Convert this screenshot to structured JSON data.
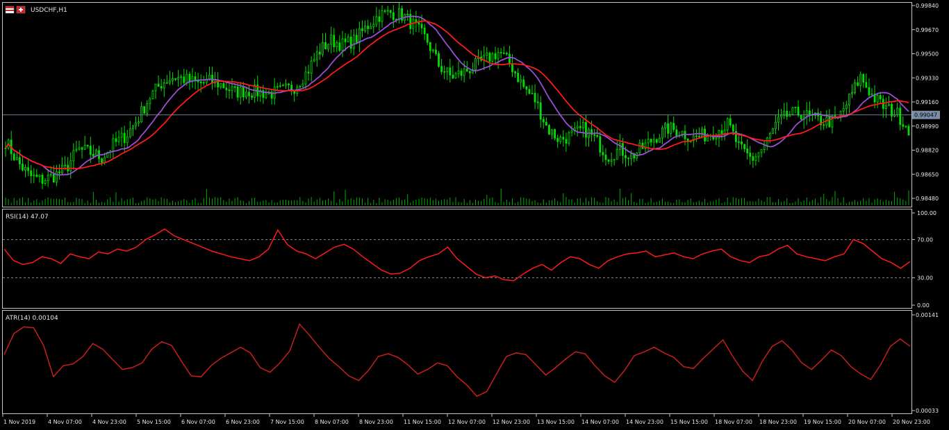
{
  "symbol_label": "USDCHF,H1",
  "colors": {
    "background": "#000000",
    "frame": "#c8c8c8",
    "candle": "#00e000",
    "volume": "#00b000",
    "ma_fast": "#9b4fd6",
    "ma_slow": "#ff1a1a",
    "rsi": "#ff1a1a",
    "atr": "#c81e1e",
    "price_line": "#7b8ca8"
  },
  "chart_data": [
    {
      "type": "candlestick",
      "title": "USDCHF,H1",
      "current_price": "0.99047",
      "current_price_value": 0.99047,
      "y_ticks": [
        "0.99840",
        "0.99670",
        "0.99500",
        "0.99330",
        "0.99160",
        "0.98990",
        "0.98820",
        "0.98650",
        "0.98480"
      ],
      "ylim": [
        0.984,
        0.9984
      ],
      "x_tick_labels": [
        "1 Nov 2019",
        "4 Nov 07:00",
        "4 Nov 23:00",
        "5 Nov 15:00",
        "6 Nov 07:00",
        "6 Nov 23:00",
        "7 Nov 15:00",
        "8 Nov 07:00",
        "8 Nov 23:00",
        "11 Nov 15:00",
        "12 Nov 07:00",
        "12 Nov 23:00",
        "13 Nov 15:00",
        "14 Nov 07:00",
        "14 Nov 23:00",
        "15 Nov 15:00",
        "18 Nov 07:00",
        "18 Nov 23:00",
        "19 Nov 15:00",
        "20 Nov 07:00",
        "20 Nov 23:00"
      ],
      "close_path": [
        0.9886,
        0.9871,
        0.9861,
        0.9858,
        0.9861,
        0.9866,
        0.988,
        0.9878,
        0.9874,
        0.9884,
        0.989,
        0.9902,
        0.9918,
        0.9928,
        0.9932,
        0.993,
        0.9927,
        0.9929,
        0.9926,
        0.9921,
        0.9922,
        0.9921,
        0.992,
        0.9922,
        0.9925,
        0.9935,
        0.995,
        0.9958,
        0.9955,
        0.9958,
        0.9968,
        0.9976,
        0.9978,
        0.9976,
        0.9968,
        0.9958,
        0.994,
        0.9932,
        0.9935,
        0.994,
        0.9945,
        0.995,
        0.994,
        0.9925,
        0.9915,
        0.9895,
        0.9887,
        0.989,
        0.9895,
        0.9887,
        0.9875,
        0.988,
        0.9875,
        0.9882,
        0.9889,
        0.9895,
        0.9893,
        0.9888,
        0.989,
        0.9893,
        0.9898,
        0.988,
        0.9873,
        0.9882,
        0.9898,
        0.9905,
        0.9906,
        0.9902,
        0.99,
        0.99,
        0.9915,
        0.9932,
        0.9918,
        0.991,
        0.9906,
        0.9895
      ],
      "series": [
        {
          "name": "",
          "type": "line",
          "role": "moving-average-fast"
        },
        {
          "name": "",
          "type": "line",
          "role": "moving-average-slow"
        }
      ]
    },
    {
      "type": "line",
      "title": "RSI(14) 47.07",
      "y_ticks": [
        "100.00",
        "70.00",
        "30.00",
        "0.00"
      ],
      "ylim": [
        0,
        100
      ],
      "levels": [
        70,
        30
      ],
      "values": [
        60,
        48,
        44,
        46,
        52,
        50,
        45,
        55,
        52,
        50,
        57,
        55,
        60,
        58,
        62,
        70,
        75,
        81,
        74,
        70,
        66,
        62,
        58,
        55,
        52,
        50,
        48,
        52,
        60,
        80,
        65,
        58,
        55,
        50,
        56,
        62,
        65,
        60,
        52,
        45,
        38,
        34,
        35,
        40,
        48,
        52,
        55,
        62,
        50,
        42,
        34,
        30,
        32,
        28,
        27,
        34,
        40,
        44,
        38,
        46,
        52,
        50,
        44,
        40,
        48,
        52,
        55,
        56,
        58,
        52,
        54,
        56,
        52,
        50,
        55,
        58,
        60,
        52,
        48,
        46,
        52,
        54,
        60,
        64,
        55,
        52,
        50,
        48,
        52,
        55,
        70,
        66,
        58,
        50,
        46,
        40,
        47
      ]
    },
    {
      "type": "line",
      "title": "ATR(14) 0.00104",
      "y_ticks": [
        "0.00141",
        "0.00033"
      ],
      "ylim": [
        0.00033,
        0.00141
      ],
      "values": [
        0.00095,
        0.00118,
        0.00125,
        0.00124,
        0.00105,
        0.00071,
        0.00083,
        0.00085,
        0.00093,
        0.00107,
        0.00101,
        0.0009,
        0.00079,
        0.00081,
        0.00086,
        0.00101,
        0.00109,
        0.00105,
        0.00088,
        0.00072,
        0.00071,
        0.00083,
        0.00091,
        0.00097,
        0.00103,
        0.00097,
        0.00081,
        0.00076,
        0.00086,
        0.00099,
        0.00128,
        0.00116,
        0.00103,
        0.00091,
        0.00082,
        0.00072,
        0.00067,
        0.00078,
        0.00093,
        0.00096,
        0.00092,
        0.00084,
        0.00074,
        0.00079,
        0.00086,
        0.00083,
        0.00071,
        0.00062,
        0.0005,
        0.00055,
        0.00074,
        0.00093,
        0.00097,
        0.00095,
        0.00084,
        0.00073,
        0.00081,
        0.0009,
        0.00098,
        0.00096,
        0.00083,
        0.00072,
        0.00065,
        0.00078,
        0.00094,
        0.00098,
        0.00103,
        0.00097,
        0.00092,
        0.00082,
        0.0008,
        0.00091,
        0.00101,
        0.00111,
        0.00093,
        0.00077,
        0.00067,
        0.00088,
        0.00104,
        0.0011,
        0.001,
        0.00086,
        0.00079,
        0.00089,
        0.001,
        0.00094,
        0.00082,
        0.00074,
        0.00068,
        0.00084,
        0.00104,
        0.00112,
        0.00104
      ]
    }
  ]
}
